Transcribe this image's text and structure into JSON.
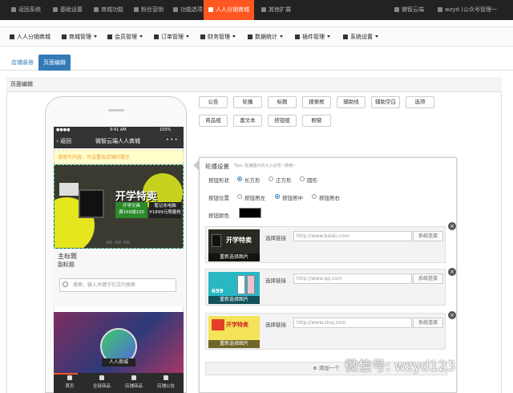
{
  "topnav": {
    "items": [
      "返回系统",
      "基础设置",
      "商城功能",
      "粉丝营销",
      "功能选项",
      "人人分销商城",
      "其他扩展"
    ],
    "right": [
      "微智云端",
      "wzyd (公众号管理一"
    ]
  },
  "menubar": {
    "brand": "人人分销商城",
    "items": [
      "商城管理",
      "会员管理",
      "订单管理",
      "财务管理",
      "数据统计",
      "插件管理",
      "系统设置"
    ]
  },
  "tabs": [
    "店铺装修",
    "页面编辑"
  ],
  "panel": {
    "title": "页面编辑"
  },
  "phone": {
    "time": "9:41 AM",
    "battery": "100%",
    "back": "返回",
    "title": "微智云端人人商城",
    "more": "• • •",
    "notice": "请填写内容，可设置各店铺的提示",
    "banner": {
      "big": "开学特卖",
      "left": "开学文具",
      "left_price": "满199减100",
      "right": "笔记本电脑",
      "right_price": "¥1899元限量抢"
    },
    "main_title": "主标题",
    "sub_title": "副标题",
    "search_placeholder": "搜索，输入关键字在店内搜索",
    "logo_text": "人人商城",
    "footer": [
      "首页",
      "全部商品",
      "店铺商品",
      "店铺公告"
    ]
  },
  "modules": [
    "公告",
    "轮播",
    "标题",
    "搜索框",
    "辅助线",
    "辅助空白",
    "选项",
    "商品组",
    "富文本",
    "按钮组",
    "橱窗"
  ],
  "editor": {
    "title": "轮播设置",
    "tip": "Tips: 轮播图片的大小必须一致哦~",
    "shape_label": "按钮形状",
    "shapes": [
      "长方形",
      "正方形",
      "圆形"
    ],
    "pos_label": "按钮位置",
    "positions": [
      "按钮居左",
      "按钮居中",
      "按钮居右"
    ],
    "color_label": "按钮颜色",
    "button_color": "#000000",
    "slides": [
      {
        "link_label": "选择链接",
        "placeholder": "http://www.baidu.com",
        "select": "系统连接",
        "reselect": "重新选择图片",
        "thumb_text": "开学特卖"
      },
      {
        "link_label": "选择链接",
        "placeholder": "http://www.qq.com",
        "select": "系统连接",
        "reselect": "重新选择图片",
        "thumb_text": "699"
      },
      {
        "link_label": "选择链接",
        "placeholder": "http://www.sina.com",
        "select": "系统连接",
        "reselect": "重新选择图片",
        "thumb_text": "开学特卖"
      }
    ],
    "add_label": "添加一个"
  },
  "watermark": "微信号: wzyd123"
}
